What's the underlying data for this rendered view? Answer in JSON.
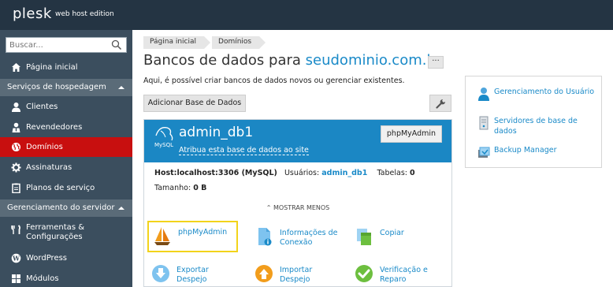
{
  "header": {
    "logo_text": "plesk",
    "edition": "web host edition"
  },
  "sidebar": {
    "search_placeholder": "Buscar...",
    "home": "Página inicial",
    "section_hosting": "Serviços de hospedagem",
    "items_hosting": [
      "Clientes",
      "Revendedores",
      "Domínios",
      "Assinaturas",
      "Planos de serviço"
    ],
    "section_server": "Gerenciamento do servidor",
    "items_server": [
      "Ferramentas & Configurações",
      "WordPress",
      "Módulos"
    ],
    "active_item": "Domínios"
  },
  "breadcrumb": [
    "Página inicial",
    "Domínios"
  ],
  "page": {
    "title_prefix": "Bancos de dados para",
    "title_domain": "seudominio.com.br",
    "more_label": "···",
    "description": "Aqui, é possível criar bancos de dados novos ou gerenciar existentes.",
    "add_db_button": "Adicionar Base de Dados"
  },
  "db": {
    "logo_text": "MySQL",
    "name": "admin_db1",
    "attach_link": "Atribua esta base de dados ao site",
    "phpmyadmin_button": "phpMyAdmin",
    "host": "Host:localhost:3306 (MySQL)",
    "users_label": "Usuários:",
    "users_value": "admin_db1",
    "tables_label": "Tabelas:",
    "tables_value": "0",
    "size_label": "Tamanho:",
    "size_value": "0 B",
    "show_less": "⌃ MOSTRAR MENOS",
    "tools": {
      "phpmyadmin": "phpMyAdmin",
      "connection_info": "Informações de Conexão",
      "copy": "Copiar",
      "export": "Exportar Despejo",
      "import": "Importar Despejo",
      "check_repair": "Verificação e Reparo"
    }
  },
  "side_panel": {
    "user_management": "Gerenciamento do Usuário",
    "db_servers": "Servidores de base de dados",
    "backup_manager": "Backup Manager"
  },
  "colors": {
    "topbar": "#243443",
    "sidebar": "#3b4e5e",
    "active": "#c80f0f",
    "db_header": "#1b87c4",
    "link": "#1a8ac8",
    "highlight": "#f2d31b"
  }
}
